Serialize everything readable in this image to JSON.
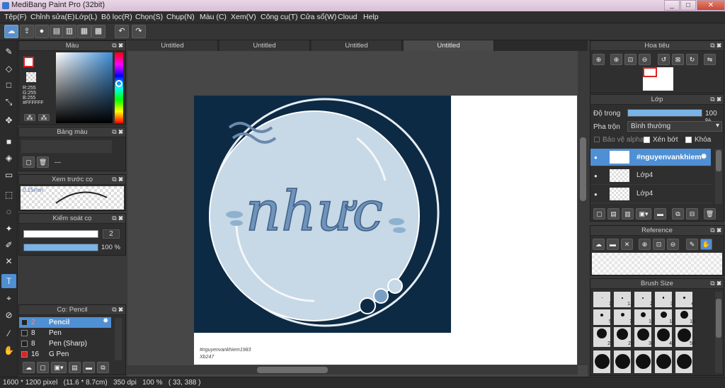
{
  "window": {
    "title": "MediBang Paint Pro (32bit)",
    "min": "_",
    "max": "□",
    "close": "✕"
  },
  "menu": [
    "Tệp(F)",
    "Chỉnh sửa(E)",
    "Lớp(L)",
    "Bộ lọc(R)",
    "Chọn(S)",
    "Chụp(N)",
    "Màu (C)",
    "Xem(V)",
    "Công cụ(T)",
    "Cửa sổ(W)",
    "Cloud",
    "Help"
  ],
  "toolbar_icons": [
    "cloud-icon",
    "share-icon",
    "comment-icon",
    "page-icon",
    "book-icon",
    "panel-icon",
    "grid-icon",
    "undo-icon",
    "redo-icon"
  ],
  "tabs": [
    "Untitled",
    "Untitled",
    "Untitled",
    "Untitled"
  ],
  "color_panel": {
    "title": "Màu",
    "readout": [
      "R:255",
      "G:255",
      "B:255",
      "#FFFFFF"
    ]
  },
  "palette_panel": {
    "title": "Bảng màu",
    "dash": "---"
  },
  "brush_preview": {
    "title": "Xem trước cọ",
    "size": "0.15mm"
  },
  "brush_control": {
    "title": "Kiểm soát cọ",
    "size": "2",
    "opacity_text": "100 %",
    "opacity_value": 100
  },
  "brush_list": {
    "title": "Cọ: Pencil",
    "items": [
      {
        "size": "2",
        "name": "Pencil",
        "color": "#222222"
      },
      {
        "size": "8",
        "name": "Pen",
        "color": "#222222"
      },
      {
        "size": "8",
        "name": "Pen (Sharp)",
        "color": "#222222"
      },
      {
        "size": "16",
        "name": "G Pen",
        "color": "#dd2222"
      }
    ]
  },
  "navigator": {
    "title": "Hoa tiêu"
  },
  "layers": {
    "title": "Lớp",
    "opacity_label": "Độ trong",
    "opacity_text": "100 %",
    "opacity_value": 100,
    "blend_label": "Pha trộn",
    "blend_value": "Bình thường",
    "alpha_label": "Bảo vệ alpha",
    "clip_label": "Xén bớt",
    "lock_label": "Khóa",
    "items": [
      {
        "name": "#nguyenvankhiem"
      },
      {
        "name": "Lớp4"
      },
      {
        "name": "Lớp4"
      }
    ]
  },
  "reference": {
    "title": "Reference"
  },
  "brush_size": {
    "title": "Brush Size",
    "sizes": [
      "1",
      "1.5",
      "2",
      "3",
      "4",
      "5",
      "7",
      "10",
      "12",
      "15",
      "20",
      "25",
      "30",
      "40",
      "50"
    ]
  },
  "artwork": {
    "text": "nhưc",
    "signature": "#nguyenvankhiem1983",
    "signature2": "Xb247"
  },
  "status": {
    "text": "1600 * 1200 pixel   (11.6 * 8.7cm)   350 dpi   100 %   ( 33, 388 )"
  },
  "colors": {
    "accent": "#4f8fd4",
    "art_bg": "#0d2a44",
    "bubble": "#c7d8e6"
  }
}
